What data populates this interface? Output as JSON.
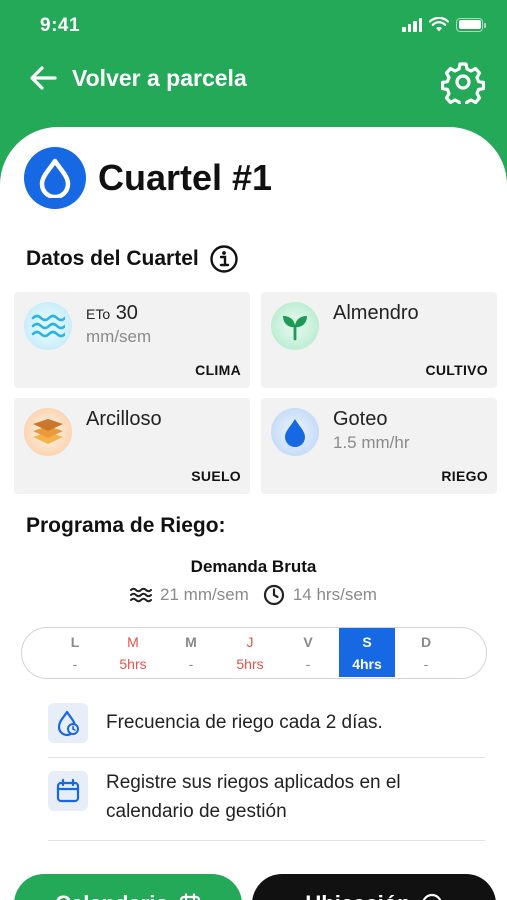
{
  "status_bar": {
    "time": "9:41"
  },
  "header": {
    "back_label": "Volver a parcela"
  },
  "title": "Cuartel #1",
  "datos": {
    "section_title": "Datos del Cuartel",
    "cards": [
      {
        "prefix": "ETo",
        "main": "30",
        "sub": "mm/sem",
        "tag": "CLIMA",
        "icon": "water-waves-icon"
      },
      {
        "main": "Almendro",
        "sub": "",
        "tag": "CULTIVO",
        "icon": "sprout-icon"
      },
      {
        "main": "Arcilloso",
        "sub": "",
        "tag": "SUELO",
        "icon": "soil-layers-icon"
      },
      {
        "main": "Goteo",
        "sub": "1.5 mm/hr",
        "tag": "RIEGO",
        "icon": "drop-icon"
      }
    ]
  },
  "programa": {
    "title": "Programa de Riego:",
    "demand_title": "Demanda Bruta",
    "demand_mm": "21 mm/sem",
    "demand_hrs": "14 hrs/sem",
    "days": [
      {
        "letter": "L",
        "value": "-"
      },
      {
        "letter": "M",
        "value": "5hrs"
      },
      {
        "letter": "M",
        "value": "-"
      },
      {
        "letter": "J",
        "value": "5hrs"
      },
      {
        "letter": "V",
        "value": "-"
      },
      {
        "letter": "S",
        "value": "4hrs"
      },
      {
        "letter": "D",
        "value": "-"
      }
    ],
    "frequency_text": "Frecuencia de riego cada 2 días.",
    "register_text_1": "Registre sus riegos aplicados en el",
    "register_text_2": "calendario de gestión"
  },
  "buttons": {
    "calendar": "Calendario",
    "location": "Ubicación"
  },
  "colors": {
    "brand_green": "#23A958",
    "accent_blue": "#1668E3",
    "highlight_red": "#E5524A"
  }
}
